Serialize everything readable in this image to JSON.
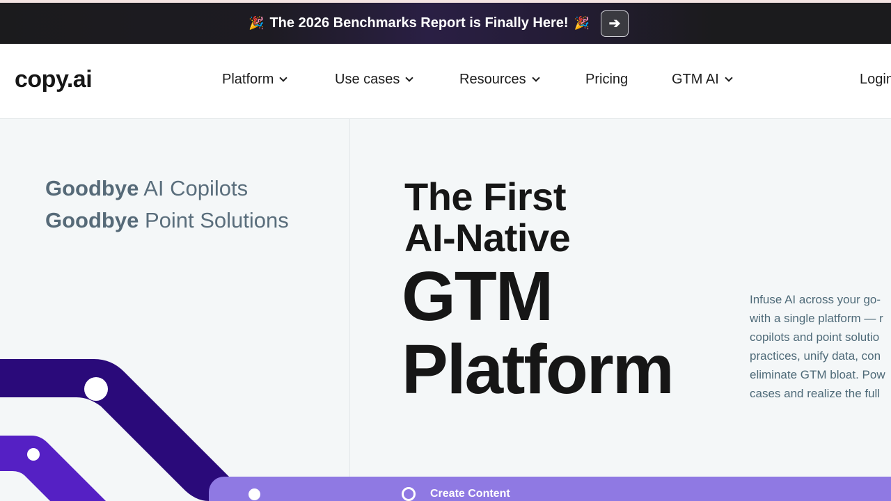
{
  "announcement": {
    "emoji_left": "🎉",
    "text": "The 2026 Benchmarks Report is Finally Here!",
    "emoji_right": "🎉",
    "button_glyph": "➔"
  },
  "nav": {
    "logo": "copy.ai",
    "items": [
      {
        "label": "Platform"
      },
      {
        "label": "Use cases"
      },
      {
        "label": "Resources"
      },
      {
        "label": "Pricing"
      },
      {
        "label": "GTM AI"
      }
    ],
    "login": "Login"
  },
  "hero": {
    "goodbye_1_bold": "Goodbye",
    "goodbye_1_rest": " AI Copilots",
    "goodbye_2_bold": "Goodbye",
    "goodbye_2_rest": " Point Solutions",
    "headline_1": "The First",
    "headline_2": "AI-Native",
    "headline_3": "GTM",
    "headline_4": "Platform",
    "description_lines": [
      "Infuse AI across your go-",
      "with a single platform — r",
      "copilots and point solutio",
      "practices, unify data, con",
      "eliminate GTM bloat. Pow",
      "cases and realize the full"
    ],
    "create_label": "Create Content"
  },
  "colors": {
    "dark_purple": "#2a0a7a",
    "mid_purple": "#5520c4",
    "light_purple": "#8f79e3",
    "text_dark": "#161616",
    "text_muted": "#5a6e7c"
  }
}
